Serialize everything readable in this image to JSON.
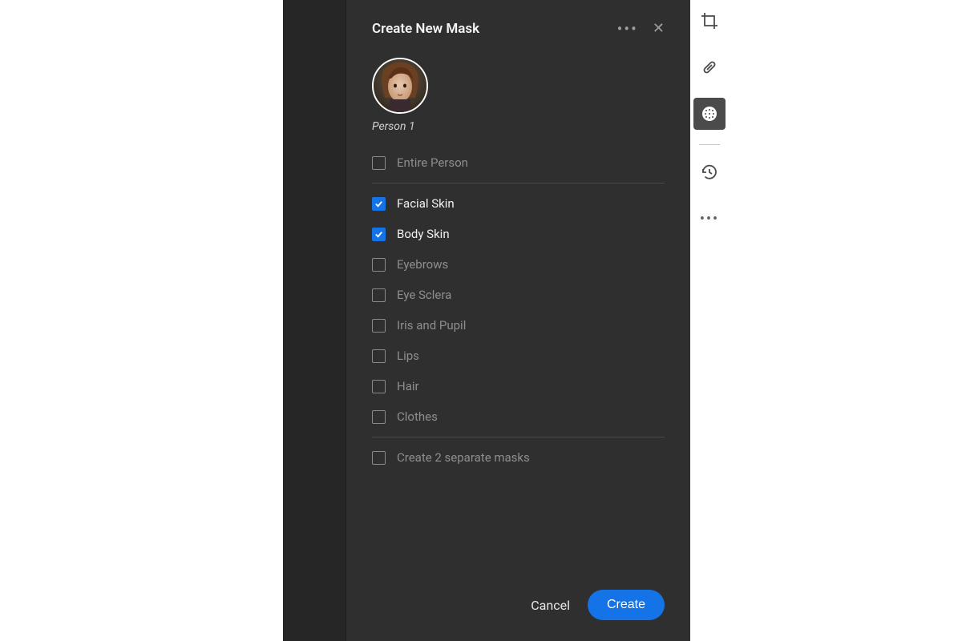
{
  "panel": {
    "title": "Create New Mask",
    "person_label": "Person 1",
    "entire_option": {
      "label": "Entire Person",
      "checked": false
    },
    "options": [
      {
        "label": "Facial Skin",
        "checked": true
      },
      {
        "label": "Body Skin",
        "checked": true
      },
      {
        "label": "Eyebrows",
        "checked": false
      },
      {
        "label": "Eye Sclera",
        "checked": false
      },
      {
        "label": "Iris and Pupil",
        "checked": false
      },
      {
        "label": "Lips",
        "checked": false
      },
      {
        "label": "Hair",
        "checked": false
      },
      {
        "label": "Clothes",
        "checked": false
      }
    ],
    "separate_option": {
      "label": "Create 2 separate masks",
      "checked": false
    },
    "cancel_label": "Cancel",
    "create_label": "Create"
  },
  "toolbar": {
    "tools": [
      {
        "name": "crop-icon",
        "active": false
      },
      {
        "name": "healing-icon",
        "active": false
      },
      {
        "name": "masking-icon",
        "active": true
      },
      {
        "name": "history-icon",
        "active": false
      },
      {
        "name": "more-icon",
        "active": false
      }
    ]
  },
  "colors": {
    "accent": "#1473e6"
  }
}
